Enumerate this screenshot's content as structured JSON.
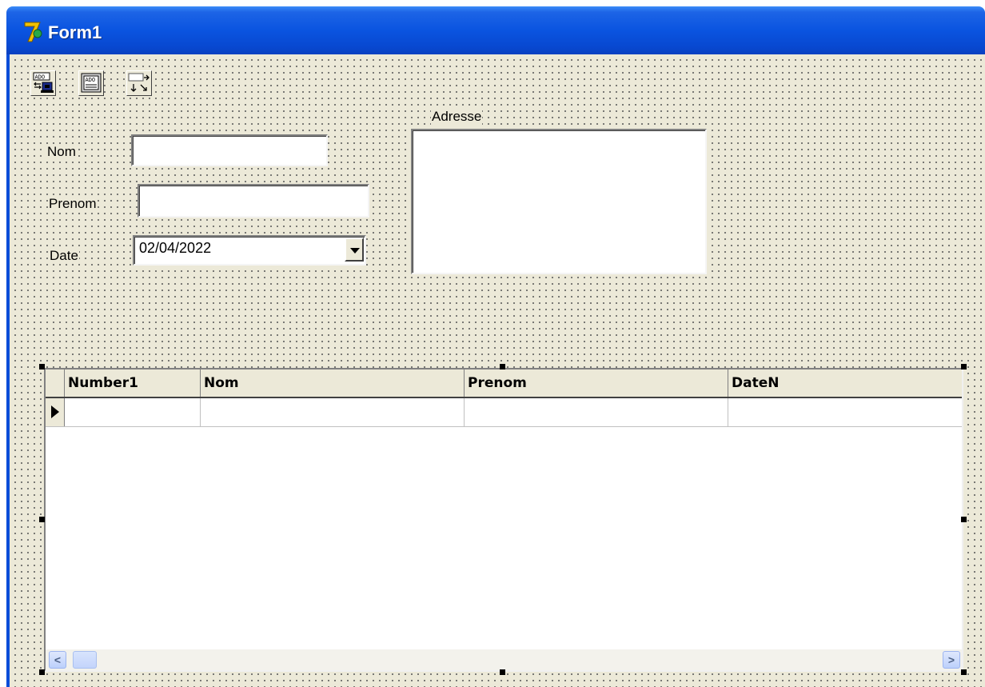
{
  "window": {
    "title": "Form1"
  },
  "toolbar": {
    "components": [
      {
        "name": "ado-connection-icon",
        "text": "ADO"
      },
      {
        "name": "ado-table-icon",
        "text": "ADO"
      },
      {
        "name": "datasource-icon",
        "text": ""
      }
    ]
  },
  "form": {
    "nom_label": "Nom",
    "nom_value": "",
    "prenom_label": "Prenom",
    "prenom_value": "",
    "date_label": "Date",
    "date_value": "02/04/2022",
    "adresse_label": "Adresse",
    "adresse_value": ""
  },
  "grid": {
    "columns": [
      "Number1",
      "Nom",
      "Prenom",
      "DateN"
    ],
    "rows": [
      [
        "",
        "",
        "",
        ""
      ]
    ]
  },
  "scrollbar": {
    "left_arrow": "<",
    "right_arrow": ">"
  },
  "colors": {
    "titlebar": "#0a54e0",
    "form_bg": "#ece9d8"
  }
}
